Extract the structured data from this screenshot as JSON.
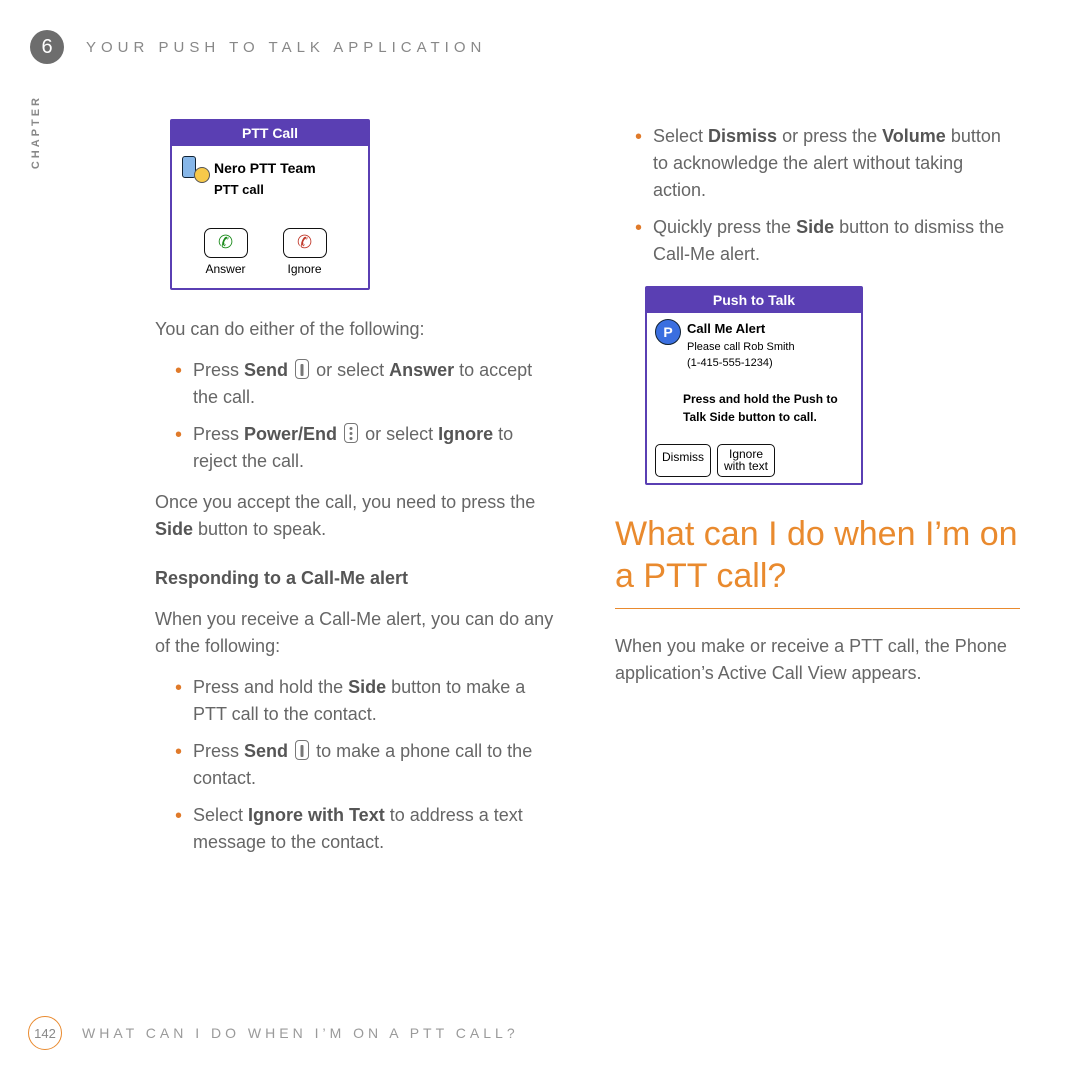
{
  "header": {
    "chapter_number": "6",
    "title": "YOUR PUSH TO TALK APPLICATION"
  },
  "sidebar": {
    "label": "CHAPTER"
  },
  "mock1": {
    "title": "PTT Call",
    "team": "Nero PTT Team",
    "sub": "PTT call",
    "answer": "Answer",
    "ignore": "Ignore"
  },
  "left": {
    "intro": "You can do either of the following:",
    "b1_a": "Press ",
    "b1_b": "Send",
    "b1_c": " or select ",
    "b1_d": "Answer",
    "b1_e": " to accept the call.",
    "b2_a": "Press ",
    "b2_b": "Power/End",
    "b2_c": " or select ",
    "b2_d": "Ignore",
    "b2_e": " to reject the call.",
    "once_a": "Once you accept the call, you need to press the ",
    "once_b": "Side",
    "once_c": " button to speak.",
    "subhead": "Responding to a Call-Me alert",
    "sub_intro": "When you receive a Call-Me alert, you can do any of the following:",
    "c1_a": "Press and hold the ",
    "c1_b": "Side",
    "c1_c": " button to make a PTT call to the contact.",
    "c2_a": "Press ",
    "c2_b": "Send",
    "c2_c": " to make a phone call to the contact.",
    "c3_a": "Select ",
    "c3_b": "Ignore with Text",
    "c3_c": " to address a text message to the contact."
  },
  "right": {
    "d1_a": "Select ",
    "d1_b": "Dismiss",
    "d1_c": " or press the ",
    "d1_d": "Volume",
    "d1_e": " button to acknowledge the alert without taking action.",
    "d2_a": "Quickly press the ",
    "d2_b": "Side",
    "d2_c": " button to dismiss the Call-Me alert.",
    "heading": "What can I do when I’m on a PTT call?",
    "after": "When you make or receive a PTT call, the Phone application’s Active Call View appears."
  },
  "mock2": {
    "title": "Push to Talk",
    "h": "Call Me Alert",
    "s1": "Please call Rob Smith",
    "s2": "(1-415-555-1234)",
    "instr": "Press and hold the Push to Talk Side button to call.",
    "dismiss": "Dismiss",
    "ignore1": "Ignore",
    "ignore2": "with text"
  },
  "footer": {
    "page": "142",
    "title": "WHAT CAN I DO WHEN I’M ON A PTT CALL?"
  }
}
